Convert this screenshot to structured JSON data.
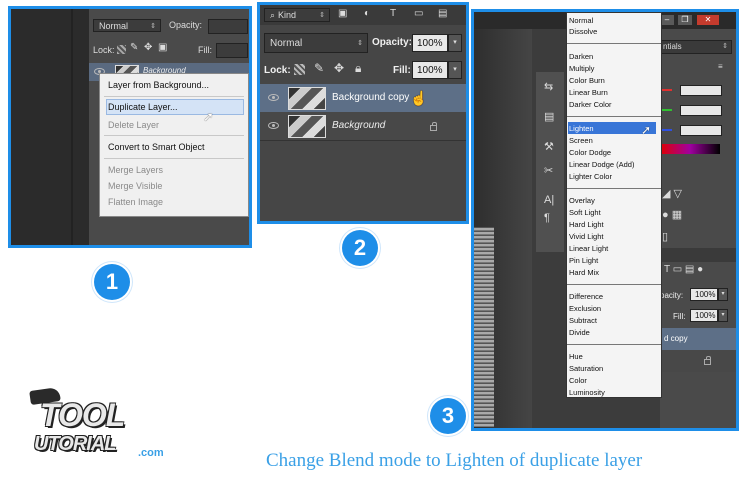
{
  "panel1": {
    "blend_mode": "Normal",
    "opacity_label": "Opacity:",
    "lock_label": "Lock:",
    "fill_label": "Fill:",
    "layer_name": "Background",
    "context_menu": {
      "items": [
        {
          "label": "Layer from Background...",
          "enabled": true
        },
        {
          "label": "Duplicate Layer...",
          "enabled": true,
          "highlighted": true
        },
        {
          "label": "Delete Layer",
          "enabled": false
        },
        {
          "label": "Convert to Smart Object",
          "enabled": true
        },
        {
          "label": "Merge Layers",
          "enabled": false
        },
        {
          "label": "Merge Visible",
          "enabled": false
        },
        {
          "label": "Flatten Image",
          "enabled": false
        }
      ]
    },
    "step": "1"
  },
  "panel2": {
    "kind_label": "Kind",
    "blend_mode": "Normal",
    "opacity_label": "Opacity:",
    "opacity_value": "100%",
    "lock_label": "Lock:",
    "fill_label": "Fill:",
    "fill_value": "100%",
    "layers": [
      {
        "name": "Background copy",
        "selected": true
      },
      {
        "name": "Background",
        "selected": false,
        "locked": true
      }
    ],
    "step": "2"
  },
  "panel3": {
    "blend_groups": [
      [
        "Normal",
        "Dissolve"
      ],
      [
        "Darken",
        "Multiply",
        "Color Burn",
        "Linear Burn",
        "Darker Color"
      ],
      [
        "Lighten",
        "Screen",
        "Color Dodge",
        "Linear Dodge (Add)",
        "Lighter Color"
      ],
      [
        "Overlay",
        "Soft Light",
        "Hard Light",
        "Vivid Light",
        "Linear Light",
        "Pin Light",
        "Hard Mix"
      ],
      [
        "Difference",
        "Exclusion",
        "Subtract",
        "Divide"
      ],
      [
        "Hue",
        "Saturation",
        "Color",
        "Luminosity"
      ]
    ],
    "highlighted": "Lighten",
    "tials_label": "ntials",
    "opacity_label": "pacity:",
    "opacity_value": "100%",
    "fill_label": "Fill:",
    "fill_value": "100%",
    "layer_fragment": "d copy",
    "step": "3"
  },
  "logo": {
    "line1": "TOOL",
    "line2": "UTORIAL",
    "suffix": ".com"
  },
  "caption": "Change Blend mode to Lighten of duplicate layer",
  "colors": {
    "accent": "#1e8ee8",
    "caption": "#3aa0e6",
    "highlight": "#3875d7"
  }
}
